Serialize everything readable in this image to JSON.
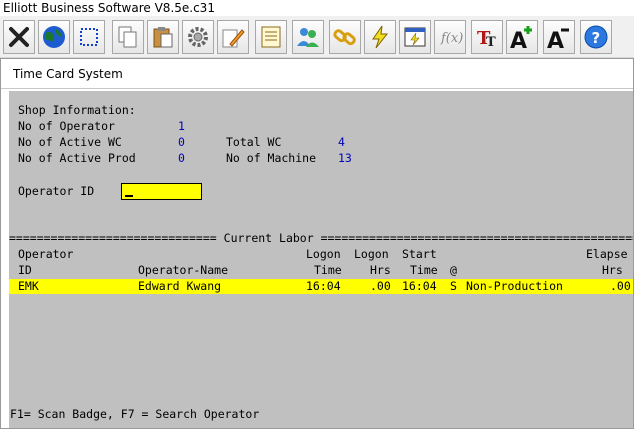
{
  "window": {
    "title": "Elliott Business Software V8.5e.c31"
  },
  "toolbar": {
    "items": [
      {
        "name": "close-icon"
      },
      {
        "name": "globe-icon"
      },
      {
        "name": "select-box-icon"
      },
      {
        "name": "copy-icon"
      },
      {
        "name": "paste-icon"
      },
      {
        "name": "settings-icon"
      },
      {
        "name": "edit-icon"
      },
      {
        "name": "notepad-icon"
      },
      {
        "name": "users-icon"
      },
      {
        "name": "link-icon"
      },
      {
        "name": "lightning-icon"
      },
      {
        "name": "screen-icon"
      },
      {
        "name": "function-icon"
      },
      {
        "name": "font-icon"
      },
      {
        "name": "font-increase-icon"
      },
      {
        "name": "font-decrease-icon"
      },
      {
        "name": "help-icon"
      }
    ]
  },
  "subwindow": {
    "title": "Time Card System"
  },
  "shop": {
    "heading": "Shop Information:",
    "no_operator_label": "No of Operator",
    "no_operator_value": "1",
    "active_wc_label": "No of Active WC",
    "active_wc_value": "0",
    "total_wc_label": "Total WC",
    "total_wc_value": "4",
    "active_prod_label": "No of Active Prod",
    "active_prod_value": "0",
    "machine_label": "No of Machine",
    "machine_value": "13"
  },
  "operator_id": {
    "label": "Operator ID",
    "value": ""
  },
  "labor": {
    "separator_title": " Current Labor ",
    "header1": {
      "operator": "Operator",
      "logon": "Logon",
      "logon2": "Logon",
      "start": "Start",
      "elapse": "Elapse"
    },
    "header2": {
      "id": "ID",
      "name": "Operator-Name",
      "time": "Time",
      "hrs": "Hrs",
      "start_time": "Time",
      "at": "@",
      "elapse_hrs": "Hrs"
    },
    "rows": [
      {
        "id": "EMK",
        "name": "Edward Kwang",
        "logon_time": "16:04",
        "logon_hrs": ".00",
        "start_time": "16:04",
        "at": "S",
        "desc": "Non-Production",
        "elapse_hrs": ".00"
      }
    ]
  },
  "footer": {
    "hint": "F1= Scan Badge, F7 = Search Operator"
  }
}
